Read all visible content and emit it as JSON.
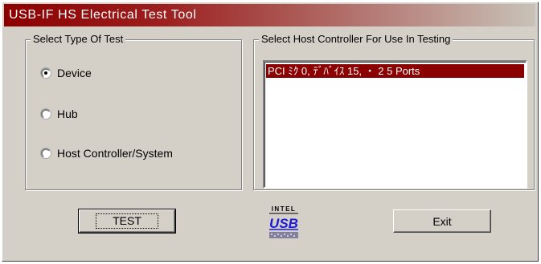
{
  "window": {
    "title": "USB-IF HS Electrical Test Tool",
    "accent_color": "#8b0000"
  },
  "test_type_group": {
    "legend": "Select Type Of Test",
    "options": [
      {
        "label": "Device",
        "selected": true
      },
      {
        "label": "Hub",
        "selected": false
      },
      {
        "label": "Host Controller/System",
        "selected": false
      }
    ]
  },
  "host_controller_group": {
    "legend": "Select Host Controller For Use In Testing",
    "items": [
      {
        "label": "PCI ﾐｸ 0, ﾃﾞﾊﾞｲｽ 15, ・ 2  5 Ports",
        "selected": true
      }
    ]
  },
  "buttons": {
    "test_label": "TEST",
    "exit_label": "Exit"
  },
  "logo": {
    "top_text": "INTEL",
    "main_text": "USB",
    "icon": "intel-usb-logo-icon"
  }
}
